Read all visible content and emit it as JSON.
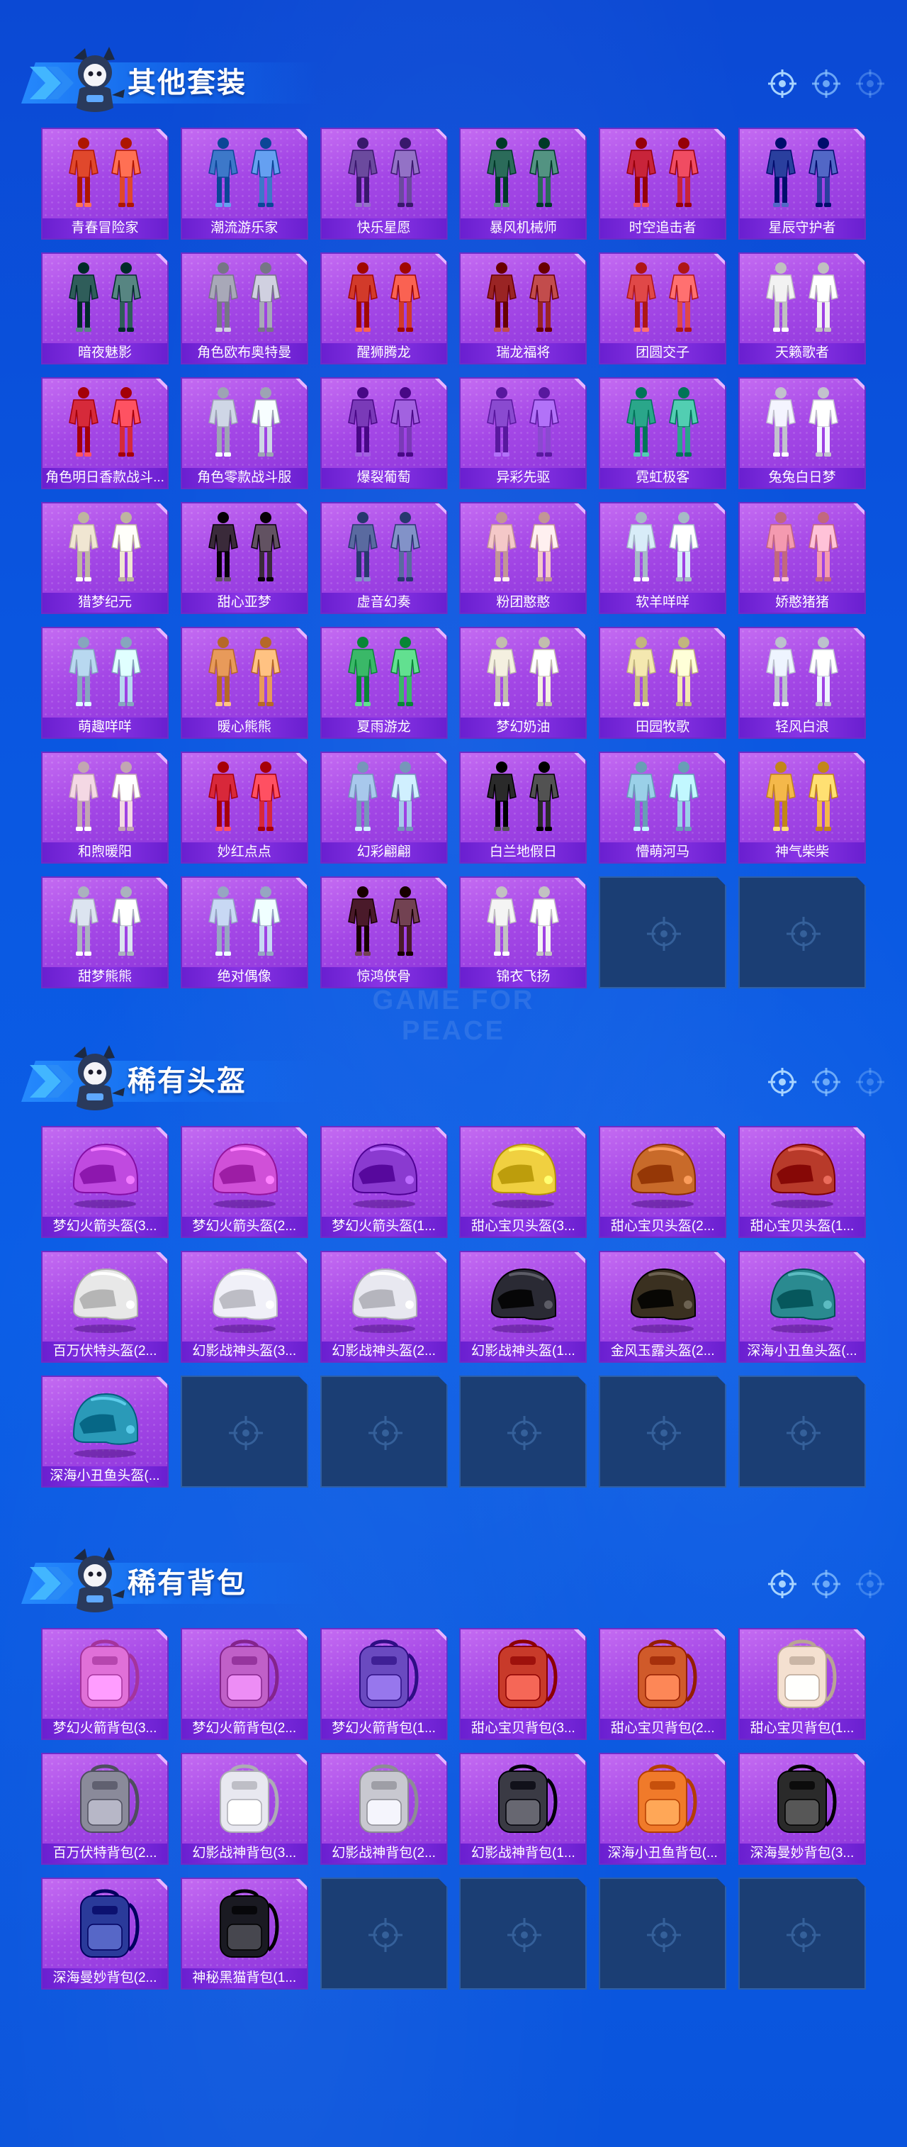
{
  "watermark": "GAME FOR PEACE",
  "colors": {
    "page_bg": "#0b52dc",
    "card_purple": "#a447e6",
    "label_bar": "#7b2ad8",
    "empty_slot": "#1b3e74"
  },
  "sections": [
    {
      "title": "其他套装",
      "items": [
        {
          "label": "青春冒险家",
          "icon": "outfit-icon",
          "color": "#e0482c"
        },
        {
          "label": "潮流游乐家",
          "icon": "outfit-icon",
          "color": "#3d78c9"
        },
        {
          "label": "快乐星愿",
          "icon": "outfit-icon",
          "color": "#6b4a9e"
        },
        {
          "label": "暴风机械师",
          "icon": "outfit-icon",
          "color": "#2b6b5a"
        },
        {
          "label": "时空追击者",
          "icon": "outfit-icon",
          "color": "#c8243a"
        },
        {
          "label": "星辰守护者",
          "icon": "outfit-icon",
          "color": "#2a3f9e"
        },
        {
          "label": "暗夜魅影",
          "icon": "outfit-icon",
          "color": "#2f5d5a"
        },
        {
          "label": "角色欧布奥特曼",
          "icon": "outfit-icon",
          "color": "#a8a8b8"
        },
        {
          "label": "醒狮腾龙",
          "icon": "outfit-icon",
          "color": "#d23a2a"
        },
        {
          "label": "瑞龙福将",
          "icon": "outfit-icon",
          "color": "#9a2424"
        },
        {
          "label": "团圆交子",
          "icon": "outfit-icon",
          "color": "#e04848"
        },
        {
          "label": "天籁歌者",
          "icon": "outfit-icon",
          "color": "#f2f2f2"
        },
        {
          "label": "角色明日香款战斗...",
          "icon": "outfit-icon",
          "color": "#d62a3a"
        },
        {
          "label": "角色零款战斗服",
          "icon": "outfit-icon",
          "color": "#cfd6e6"
        },
        {
          "label": "爆裂葡萄",
          "icon": "outfit-icon",
          "color": "#7a3ab8"
        },
        {
          "label": "异彩先驱",
          "icon": "outfit-icon",
          "color": "#8a4ad0"
        },
        {
          "label": "霓虹极客",
          "icon": "outfit-icon",
          "color": "#2aa68a"
        },
        {
          "label": "兔兔白日梦",
          "icon": "outfit-icon",
          "color": "#f4f4ff"
        },
        {
          "label": "猎梦纪元",
          "icon": "outfit-icon",
          "color": "#f0e6d2"
        },
        {
          "label": "甜心亚梦",
          "icon": "outfit-icon",
          "color": "#3a2a3a"
        },
        {
          "label": "虚音幻奏",
          "icon": "outfit-icon",
          "color": "#5a6aa0"
        },
        {
          "label": "粉团憨憨",
          "icon": "outfit-icon",
          "color": "#f4c8c8"
        },
        {
          "label": "软羊咩咩",
          "icon": "outfit-icon",
          "color": "#d8ecf8"
        },
        {
          "label": "娇憨猪猪",
          "icon": "outfit-icon",
          "color": "#f49ab0"
        },
        {
          "label": "萌趣咩咩",
          "icon": "outfit-icon",
          "color": "#b8d8f0"
        },
        {
          "label": "暖心熊熊",
          "icon": "outfit-icon",
          "color": "#e89a5a"
        },
        {
          "label": "夏雨游龙",
          "icon": "outfit-icon",
          "color": "#3ab868"
        },
        {
          "label": "梦幻奶油",
          "icon": "outfit-icon",
          "color": "#f4f0e0"
        },
        {
          "label": "田园牧歌",
          "icon": "outfit-icon",
          "color": "#f4e8b0"
        },
        {
          "label": "轻风白浪",
          "icon": "outfit-icon",
          "color": "#eef4ff"
        },
        {
          "label": "和煦暖阳",
          "icon": "outfit-icon",
          "color": "#f4d8e4"
        },
        {
          "label": "妙红点点",
          "icon": "outfit-icon",
          "color": "#d8283a"
        },
        {
          "label": "幻彩翩翩",
          "icon": "outfit-icon",
          "color": "#a8c8ec"
        },
        {
          "label": "白兰地假日",
          "icon": "outfit-icon",
          "color": "#2a2a2a"
        },
        {
          "label": "懵萌河马",
          "icon": "outfit-icon",
          "color": "#9ad0e8"
        },
        {
          "label": "神气柴柴",
          "icon": "outfit-icon",
          "color": "#f4b84a"
        },
        {
          "label": "甜梦熊熊",
          "icon": "outfit-icon",
          "color": "#dce4f0"
        },
        {
          "label": "绝对偶像",
          "icon": "outfit-icon",
          "color": "#c8d8f4"
        },
        {
          "label": "惊鸿侠骨",
          "icon": "outfit-icon",
          "color": "#4a1a2a"
        },
        {
          "label": "锦衣飞扬",
          "icon": "outfit-icon",
          "color": "#f4f4f4"
        }
      ]
    },
    {
      "title": "稀有头盔",
      "items": [
        {
          "label": "梦幻火箭头盔(3...",
          "icon": "helmet-icon",
          "color": "#c04ae0"
        },
        {
          "label": "梦幻火箭头盔(2...",
          "icon": "helmet-icon",
          "color": "#d050d8"
        },
        {
          "label": "梦幻火箭头盔(1...",
          "icon": "helmet-icon",
          "color": "#8a3ad0"
        },
        {
          "label": "甜心宝贝头盔(3...",
          "icon": "helmet-icon",
          "color": "#f0d040"
        },
        {
          "label": "甜心宝贝头盔(2...",
          "icon": "helmet-icon",
          "color": "#c86a2a"
        },
        {
          "label": "甜心宝贝头盔(1...",
          "icon": "helmet-icon",
          "color": "#b83a2a"
        },
        {
          "label": "百万伏特头盔(2...",
          "icon": "helmet-icon",
          "color": "#e8e8e8"
        },
        {
          "label": "幻影战神头盔(3...",
          "icon": "helmet-icon",
          "color": "#f0f0f8"
        },
        {
          "label": "幻影战神头盔(2...",
          "icon": "helmet-icon",
          "color": "#e8e8f0"
        },
        {
          "label": "幻影战神头盔(1...",
          "icon": "helmet-icon",
          "color": "#2a2a34"
        },
        {
          "label": "金风玉露头盔(2...",
          "icon": "helmet-icon",
          "color": "#3a3020"
        },
        {
          "label": "深海小丑鱼头盔(...",
          "icon": "helmet-icon",
          "color": "#2a8a90"
        },
        {
          "label": "深海小丑鱼头盔(...",
          "icon": "helmet-icon",
          "color": "#2a9ab8"
        }
      ]
    },
    {
      "title": "稀有背包",
      "items": [
        {
          "label": "梦幻火箭背包(3...",
          "icon": "backpack-icon",
          "color": "#e070d8"
        },
        {
          "label": "梦幻火箭背包(2...",
          "icon": "backpack-icon",
          "color": "#c060c8"
        },
        {
          "label": "梦幻火箭背包(1...",
          "icon": "backpack-icon",
          "color": "#6a4ac0"
        },
        {
          "label": "甜心宝贝背包(3...",
          "icon": "backpack-icon",
          "color": "#c83a2a"
        },
        {
          "label": "甜心宝贝背包(2...",
          "icon": "backpack-icon",
          "color": "#d05a2a"
        },
        {
          "label": "甜心宝贝背包(1...",
          "icon": "backpack-icon",
          "color": "#f4e0d0"
        },
        {
          "label": "百万伏特背包(2...",
          "icon": "backpack-icon",
          "color": "#8a8a9a"
        },
        {
          "label": "幻影战神背包(3...",
          "icon": "backpack-icon",
          "color": "#e8e8f0"
        },
        {
          "label": "幻影战神背包(2...",
          "icon": "backpack-icon",
          "color": "#c8c8d0"
        },
        {
          "label": "幻影战神背包(1...",
          "icon": "backpack-icon",
          "color": "#3a3a44"
        },
        {
          "label": "深海小丑鱼背包(...",
          "icon": "backpack-icon",
          "color": "#f07a2a"
        },
        {
          "label": "深海曼妙背包(3...",
          "icon": "backpack-icon",
          "color": "#2a2a2a"
        },
        {
          "label": "深海曼妙背包(2...",
          "icon": "backpack-icon",
          "color": "#2a3a9a"
        },
        {
          "label": "神秘黑猫背包(1...",
          "icon": "backpack-icon",
          "color": "#1a1a22"
        }
      ]
    }
  ]
}
